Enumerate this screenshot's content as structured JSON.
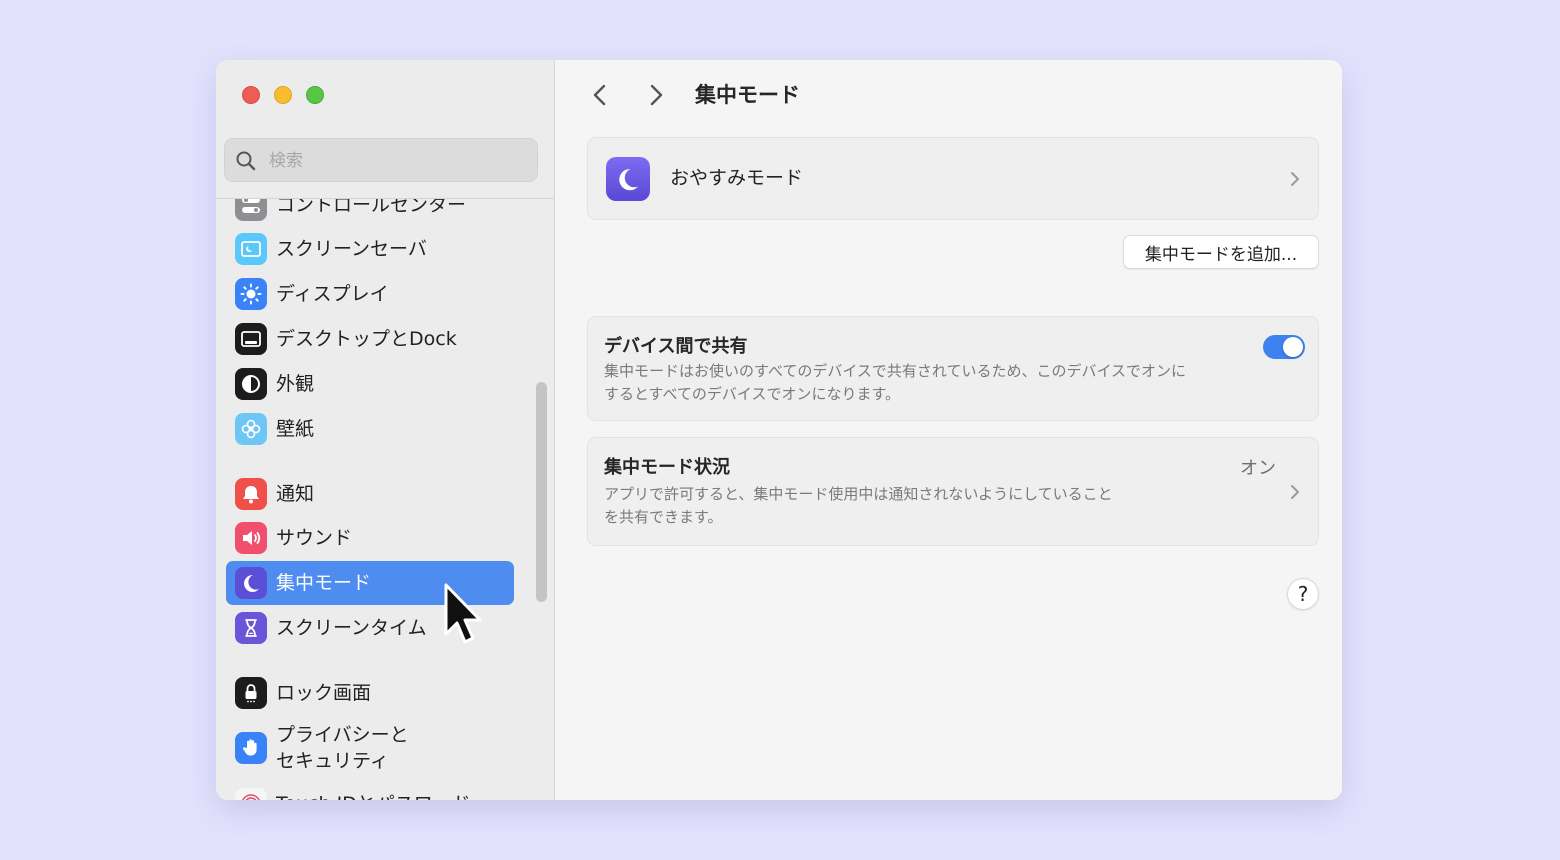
{
  "sidebar": {
    "search_placeholder": "検索",
    "items": [
      {
        "label": "コントロールセンター",
        "icon": "control-center-icon",
        "color": "#8e8e93"
      },
      {
        "label": "スクリーンセーバ",
        "icon": "screensaver-icon",
        "color": "#5ac8fa"
      },
      {
        "label": "ディスプレイ",
        "icon": "display-brightness-icon",
        "color": "#3a82f7"
      },
      {
        "label": "デスクトップとDock",
        "icon": "desktop-dock-icon",
        "color": "#1c1c1e"
      },
      {
        "label": "外観",
        "icon": "appearance-icon",
        "color": "#1c1c1e"
      },
      {
        "label": "壁紙",
        "icon": "wallpaper-flower-icon",
        "color": "#6ec6f5"
      },
      {
        "label": "通知",
        "icon": "notification-bell-icon",
        "color": "#f0504a"
      },
      {
        "label": "サウンド",
        "icon": "speaker-icon",
        "color": "#f0506e"
      },
      {
        "label": "集中モード",
        "icon": "moon-icon",
        "color": "#5b4fd8",
        "active": true
      },
      {
        "label": "スクリーンタイム",
        "icon": "hourglass-icon",
        "color": "#6a55d8"
      },
      {
        "label": "ロック画面",
        "icon": "lock-icon",
        "color": "#1c1c1e"
      },
      {
        "label_line1": "プライバシーと",
        "label_line2": "セキュリティ",
        "icon": "hand-icon",
        "color": "#3a82f7"
      },
      {
        "label": "Touch IDとパスワード",
        "icon": "fingerprint-icon",
        "color": "#f5f5f5"
      }
    ]
  },
  "main": {
    "title": "集中モード",
    "focus_modes": [
      {
        "label": "おやすみモード",
        "icon": "moon-icon"
      }
    ],
    "add_button_label": "集中モードを追加...",
    "share_across_devices": {
      "title": "デバイス間で共有",
      "description_line1": "集中モードはお使いのすべてのデバイスで共有されているため、このデバイスでオンに",
      "description_line2": "するとすべてのデバイスでオンになります。",
      "enabled": true
    },
    "focus_status": {
      "title": "集中モード状況",
      "value": "オン",
      "description_line1": "アプリで許可すると、集中モード使用中は通知されないようにしていること",
      "description_line2": "を共有できます。"
    },
    "help_label": "?"
  },
  "colors": {
    "accent": "#3e82f0",
    "selection": "#4f8cf0",
    "background": "#e3e2fd"
  }
}
